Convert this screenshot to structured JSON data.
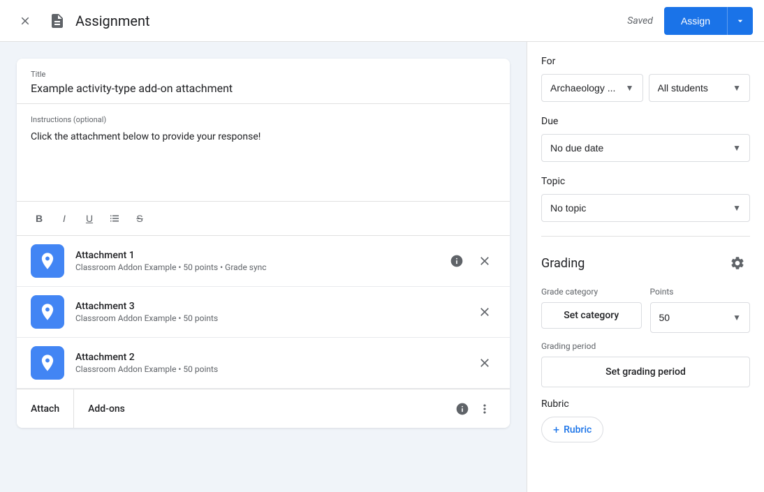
{
  "header": {
    "title": "Assignment",
    "saved_label": "Saved",
    "assign_label": "Assign"
  },
  "assignment": {
    "title_label": "Title",
    "title_value": "Example activity-type add-on attachment",
    "instructions_label": "Instructions (optional)",
    "instructions_text": "Click the attachment below to provide your response!",
    "attachments": [
      {
        "name": "Attachment 1",
        "meta": "Classroom Addon Example • 50 points • Grade sync"
      },
      {
        "name": "Attachment 3",
        "meta": "Classroom Addon Example • 50 points"
      },
      {
        "name": "Attachment 2",
        "meta": "Classroom Addon Example • 50 points"
      }
    ],
    "attach_label": "Attach",
    "addons_label": "Add-ons"
  },
  "sidebar": {
    "for_label": "For",
    "class_value": "Archaeology ...",
    "students_value": "All students",
    "due_label": "Due",
    "due_value": "No due date",
    "topic_label": "Topic",
    "topic_value": "No topic",
    "grading_title": "Grading",
    "grade_category_label": "Grade category",
    "points_label": "Points",
    "set_category_label": "Set category",
    "points_value": "50",
    "grading_period_label": "Grading period",
    "set_grading_period_label": "Set grading period",
    "rubric_label": "Rubric",
    "add_rubric_label": "Rubric"
  }
}
